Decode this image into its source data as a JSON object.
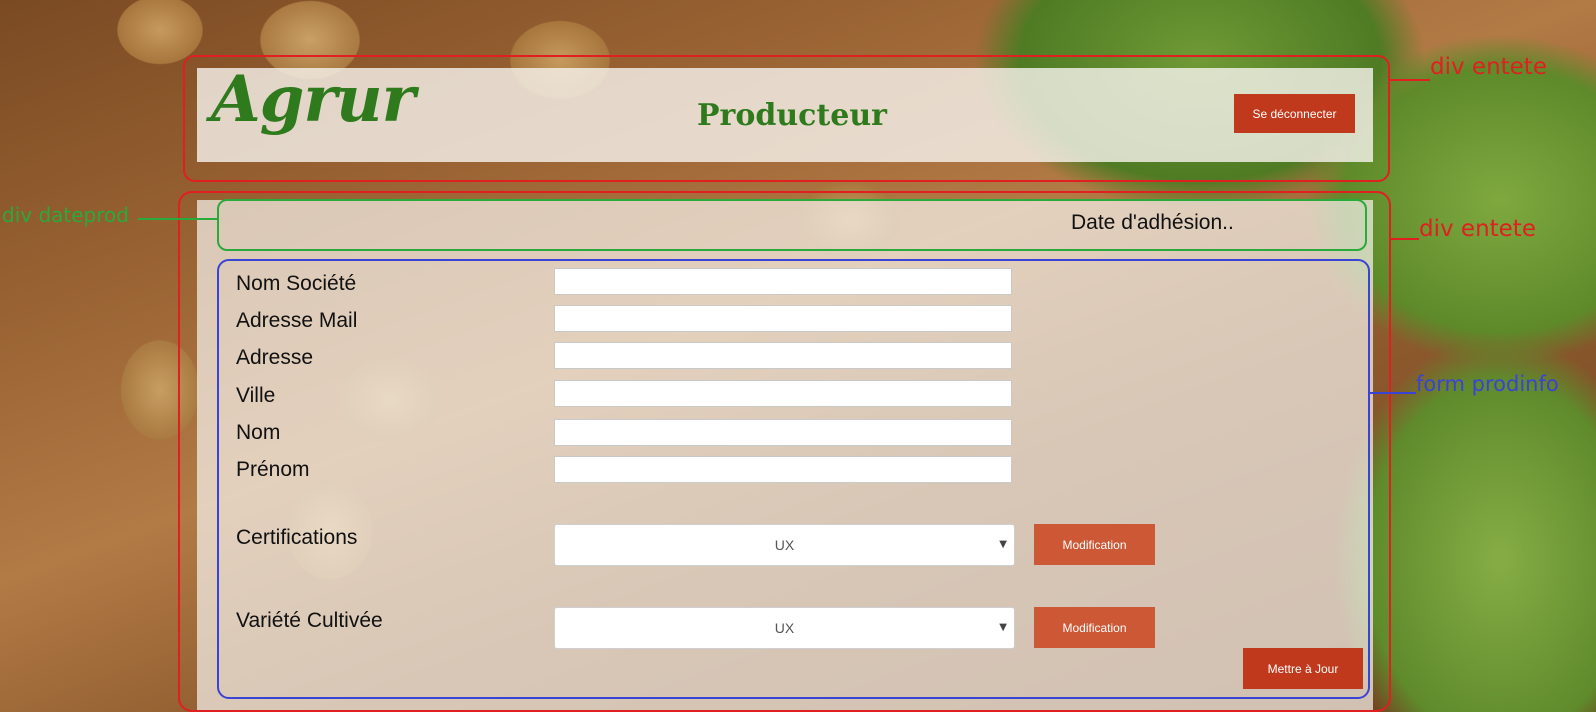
{
  "header": {
    "logo_text": "Agrur",
    "role_title": "Producteur",
    "logout_label": "Se déconnecter"
  },
  "date_section": {
    "text": "Date d'adhésion.."
  },
  "form": {
    "fields": [
      {
        "label": "Nom Société",
        "value": ""
      },
      {
        "label": "Adresse Mail",
        "value": ""
      },
      {
        "label": "Adresse",
        "value": ""
      },
      {
        "label": "Ville",
        "value": ""
      },
      {
        "label": "Nom",
        "value": ""
      },
      {
        "label": "Prénom",
        "value": ""
      }
    ],
    "certifications": {
      "label": "Certifications",
      "selected": "UX",
      "button_label": "Modification"
    },
    "variete": {
      "label": "Variété Cultivée",
      "selected": "UX",
      "button_label": "Modification"
    },
    "submit_label": "Mettre à Jour"
  },
  "annotations": {
    "entete_label": "div entete",
    "entete_label_2": "div entete",
    "dateprod_label": "div dateprod",
    "form_label": "form prodinfo",
    "colors": {
      "red": "#e02020",
      "green": "#2aaa3a",
      "blue": "#3a44d4"
    }
  },
  "colors": {
    "brand_green": "#2e7a1c",
    "button_red": "#c0391c",
    "button_orange": "#cc5836"
  }
}
